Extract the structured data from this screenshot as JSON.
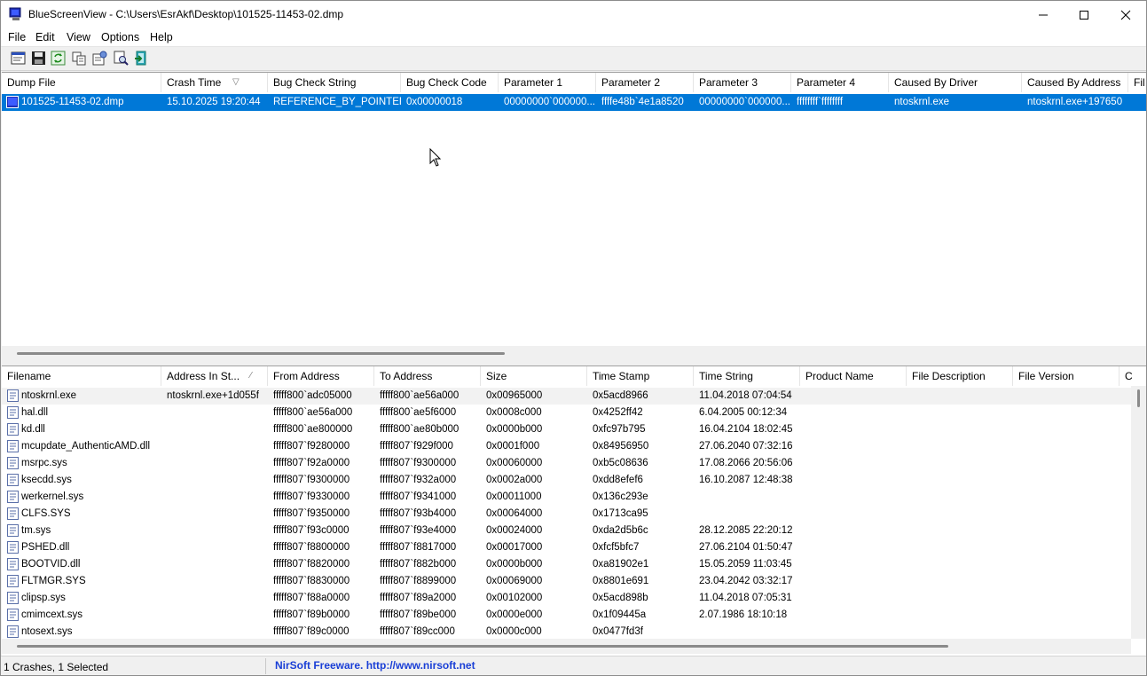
{
  "window": {
    "title": "BlueScreenView  -  C:\\Users\\EsrAkf\\Desktop\\101525-11453-02.dmp"
  },
  "menu": [
    "File",
    "Edit",
    "View",
    "Options",
    "Help"
  ],
  "toolbar": [
    "properties-icon",
    "save-icon",
    "refresh-icon",
    "copy-icon",
    "options-icon",
    "find-icon",
    "exit-icon"
  ],
  "upper": {
    "columns": [
      "Dump File",
      "Crash Time",
      "Bug Check String",
      "Bug Check Code",
      "Parameter 1",
      "Parameter 2",
      "Parameter 3",
      "Parameter 4",
      "Caused By Driver",
      "Caused By Address",
      "Fil"
    ],
    "rows": [
      [
        "101525-11453-02.dmp",
        "15.10.2025 19:20:44",
        "REFERENCE_BY_POINTER",
        "0x00000018",
        "00000000`000000...",
        "ffffe48b`4e1a8520",
        "00000000`000000...",
        "ffffffff`ffffffff",
        "ntoskrnl.exe",
        "ntoskrnl.exe+197650",
        ""
      ]
    ]
  },
  "lower": {
    "columns": [
      "Filename",
      "Address In St...",
      "From Address",
      "To Address",
      "Size",
      "Time Stamp",
      "Time String",
      "Product Name",
      "File Description",
      "File Version",
      "C"
    ],
    "rows": [
      [
        "ntoskrnl.exe",
        "ntoskrnl.exe+1d055f",
        "fffff800`adc05000",
        "fffff800`ae56a000",
        "0x00965000",
        "0x5acd8966",
        "11.04.2018 07:04:54"
      ],
      [
        "hal.dll",
        "",
        "fffff800`ae56a000",
        "fffff800`ae5f6000",
        "0x0008c000",
        "0x4252ff42",
        "6.04.2005 00:12:34"
      ],
      [
        "kd.dll",
        "",
        "fffff800`ae800000",
        "fffff800`ae80b000",
        "0x0000b000",
        "0xfc97b795",
        "16.04.2104 18:02:45"
      ],
      [
        "mcupdate_AuthenticAMD.dll",
        "",
        "fffff807`f9280000",
        "fffff807`f929f000",
        "0x0001f000",
        "0x84956950",
        "27.06.2040 07:32:16"
      ],
      [
        "msrpc.sys",
        "",
        "fffff807`f92a0000",
        "fffff807`f9300000",
        "0x00060000",
        "0xb5c08636",
        "17.08.2066 20:56:06"
      ],
      [
        "ksecdd.sys",
        "",
        "fffff807`f9300000",
        "fffff807`f932a000",
        "0x0002a000",
        "0xdd8efef6",
        "16.10.2087 12:48:38"
      ],
      [
        "werkernel.sys",
        "",
        "fffff807`f9330000",
        "fffff807`f9341000",
        "0x00011000",
        "0x136c293e",
        ""
      ],
      [
        "CLFS.SYS",
        "",
        "fffff807`f9350000",
        "fffff807`f93b4000",
        "0x00064000",
        "0x1713ca95",
        ""
      ],
      [
        "tm.sys",
        "",
        "fffff807`f93c0000",
        "fffff807`f93e4000",
        "0x00024000",
        "0xda2d5b6c",
        "28.12.2085 22:20:12"
      ],
      [
        "PSHED.dll",
        "",
        "fffff807`f8800000",
        "fffff807`f8817000",
        "0x00017000",
        "0xfcf5bfc7",
        "27.06.2104 01:50:47"
      ],
      [
        "BOOTVID.dll",
        "",
        "fffff807`f8820000",
        "fffff807`f882b000",
        "0x0000b000",
        "0xa81902e1",
        "15.05.2059 11:03:45"
      ],
      [
        "FLTMGR.SYS",
        "",
        "fffff807`f8830000",
        "fffff807`f8899000",
        "0x00069000",
        "0x8801e691",
        "23.04.2042 03:32:17"
      ],
      [
        "clipsp.sys",
        "",
        "fffff807`f88a0000",
        "fffff807`f89a2000",
        "0x00102000",
        "0x5acd898b",
        "11.04.2018 07:05:31"
      ],
      [
        "cmimcext.sys",
        "",
        "fffff807`f89b0000",
        "fffff807`f89be000",
        "0x0000e000",
        "0x1f09445a",
        "2.07.1986 18:10:18"
      ],
      [
        "ntosext.sys",
        "",
        "fffff807`f89c0000",
        "fffff807`f89cc000",
        "0x0000c000",
        "0x0477fd3f",
        ""
      ]
    ]
  },
  "status": {
    "crashes": "1 Crashes, 1 Selected",
    "credit": "NirSoft Freeware.  http://www.nirsoft.net"
  },
  "colors": {
    "selection": "#0078d7",
    "link": "#1a3fd6"
  }
}
